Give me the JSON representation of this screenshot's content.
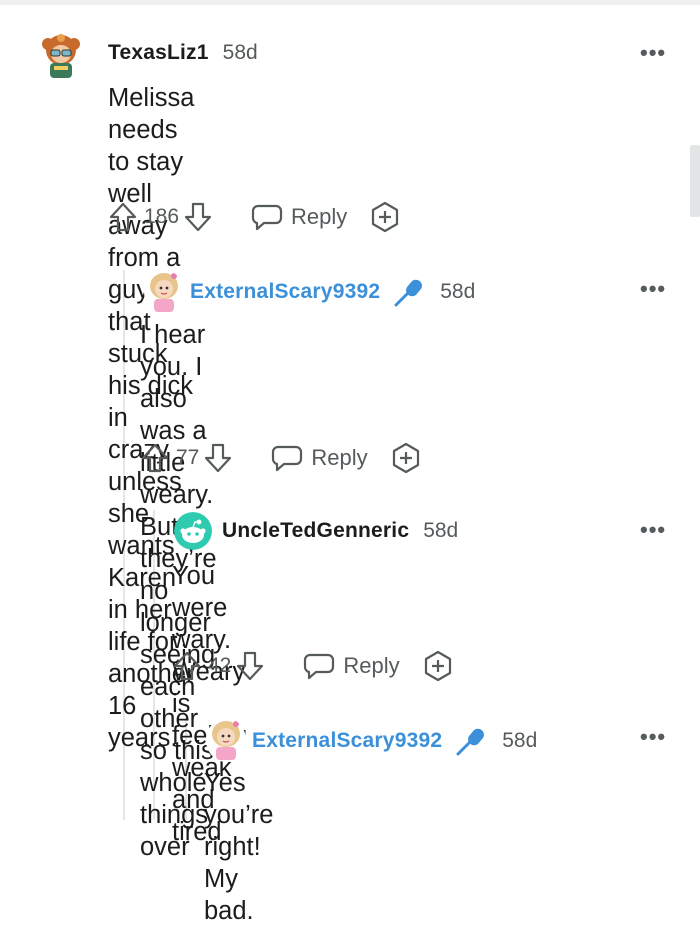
{
  "comments": [
    {
      "username": "TexasLiz1",
      "age": "58d",
      "body_lines": [
        "Melissa needs to stay well away from a guy",
        "that stuck his dick in crazy unless she wants",
        "Karen in her life for another 16 years."
      ],
      "votes": "186",
      "reply_label": "Reply",
      "more": "•••"
    },
    {
      "username": "ExternalScary9392",
      "age": "58d",
      "body_lines": [
        "I hear you. I also was a little weary. But",
        "they’re no longer seeing each other so this",
        "whole things over"
      ],
      "votes": "77",
      "reply_label": "Reply",
      "more": "•••"
    },
    {
      "username": "UncleTedGenneric",
      "age": "58d",
      "body_lines": [
        "You were wary. Weary is feeling weak",
        "and tired"
      ],
      "votes": "42",
      "reply_label": "Reply",
      "more": "•••"
    },
    {
      "username": "ExternalScary9392",
      "age": "58d",
      "body_lines": [
        "Yes you’re right! My bad."
      ],
      "more": "•••"
    }
  ],
  "colors": {
    "username_op_flair": "#3b90d9",
    "meta_gray": "#555a5c",
    "thread_line": "#e4e6e7",
    "snoo_teal": "#2ecbb0"
  },
  "icons": [
    "upvote-icon",
    "downvote-icon",
    "reply-bubble-icon",
    "award-plus-icon",
    "microphone-icon",
    "more-options-icon"
  ]
}
